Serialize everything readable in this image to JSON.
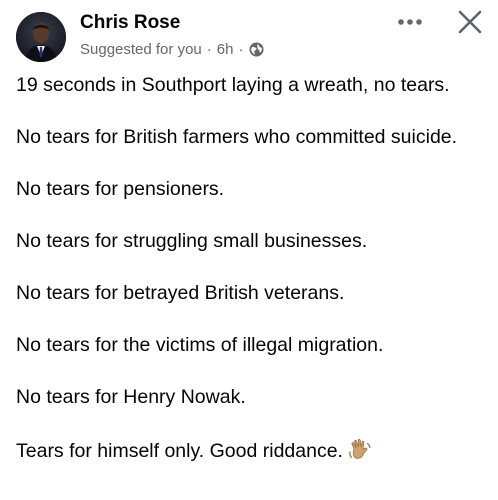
{
  "post": {
    "author": "Chris Rose",
    "context": "Suggested for you",
    "separator": "·",
    "time": "6h",
    "audience_icon": "globe-icon",
    "paragraphs": [
      "19 seconds in Southport laying a wreath, no tears.",
      "No tears for British farmers who committed suicide.",
      "No tears for pensioners.",
      "No tears for struggling small businesses.",
      "No tears for betrayed British veterans.",
      "No tears for the victims of illegal migration.",
      "No tears for Henry Nowak.",
      "Tears for himself only. Good riddance."
    ],
    "final_emoji": "waving-hand-emoji"
  },
  "actions": {
    "more_icon": "more-horizontal-icon",
    "close_icon": "close-icon"
  },
  "colors": {
    "text_primary": "#050505",
    "text_secondary": "#65676b",
    "background": "#ffffff"
  }
}
